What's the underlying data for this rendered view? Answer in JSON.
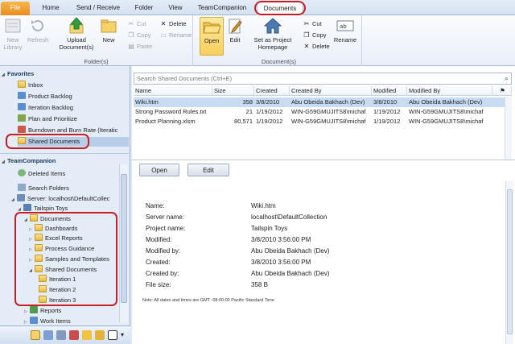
{
  "tabs": [
    {
      "label": "File"
    },
    {
      "label": "Home"
    },
    {
      "label": "Send / Receive"
    },
    {
      "label": "Folder"
    },
    {
      "label": "View"
    },
    {
      "label": "TeamCompanion"
    },
    {
      "label": "Documents"
    }
  ],
  "ribbon": {
    "folder_group": {
      "label": "Folder(s)",
      "new_library": "New Library",
      "refresh": "Refresh",
      "upload": "Upload Document(s)",
      "new": "New",
      "cut": "Cut",
      "copy": "Copy",
      "paste": "Paste",
      "delete": "Delete",
      "rename": "Rename"
    },
    "document_group": {
      "label": "Document(s)",
      "open": "Open",
      "edit": "Edit",
      "set_home": "Set as Project Homepage",
      "cut": "Cut",
      "copy": "Copy",
      "delete": "Delete",
      "rename": "Rename"
    }
  },
  "nav": {
    "favorites_header": "Favorites",
    "favorites": [
      {
        "label": "Inbox"
      },
      {
        "label": "Product Backlog"
      },
      {
        "label": "Iteration Backlog"
      },
      {
        "label": "Plan and Prioritize"
      },
      {
        "label": "Burndown and Burn Rate (Iteratic"
      },
      {
        "label": "Shared Documents"
      }
    ],
    "tc_header": "TeamCompanion",
    "deleted_items": "Deleted Items",
    "search_folders": "Search Folders",
    "server": "Server: localhost\\DefaultCollec",
    "project": "Tailspin Toys",
    "documents": "Documents",
    "doc_folders": [
      {
        "label": "Dashboards"
      },
      {
        "label": "Excel Reports"
      },
      {
        "label": "Process Guidance"
      },
      {
        "label": "Samples and Templates"
      },
      {
        "label": "Shared Documents"
      }
    ],
    "iterations": [
      {
        "label": "Iteration 1"
      },
      {
        "label": "Iteration 2"
      },
      {
        "label": "Iteration 3"
      }
    ],
    "reports": "Reports",
    "work_items": "Work Items"
  },
  "search": {
    "placeholder": "Search Shared Documents (Ctrl+E)"
  },
  "grid": {
    "headers": {
      "name": "Name",
      "size": "Size",
      "created": "Created",
      "created_by": "Created By",
      "modified": "Modified",
      "modified_by": "Modified By"
    },
    "rows": [
      {
        "name": "Wiki.htm",
        "size": "358",
        "created": "3/8/2010",
        "created_by": "Abu Obeida Bakhach (Dev)",
        "modified": "3/8/2010",
        "modified_by": "Abu Obeida Bakhach (Dev)"
      },
      {
        "name": "Strong Password Rules.txt",
        "size": "21",
        "created": "1/19/2012",
        "created_by": "WIN-G59GMUJITS8\\michaf",
        "modified": "1/19/2012",
        "modified_by": "WIN-G59GMUJITS8\\michaf"
      },
      {
        "name": "Product Planning.xlsm",
        "size": "80,571",
        "created": "1/19/2012",
        "created_by": "WIN-G59GMUJITS8\\michaf",
        "modified": "1/19/2012",
        "modified_by": "WIN-G59GMUJITS8\\michaf"
      }
    ]
  },
  "preview": {
    "open": "Open",
    "edit": "Edit",
    "fields": [
      {
        "label": "Name:",
        "value": "Wiki.htm"
      },
      {
        "label": "Server name:",
        "value": "localhost\\DefaultCollection"
      },
      {
        "label": "Project name:",
        "value": "Tailspin Toys"
      },
      {
        "label": "Modified:",
        "value": "3/8/2010 3:56:00 PM"
      },
      {
        "label": "Modified by:",
        "value": "Abu Obeida Bakhach (Dev)"
      },
      {
        "label": "Created:",
        "value": "3/8/2010 3:56:00 PM"
      },
      {
        "label": "Created by:",
        "value": "Abu Obeida Bakhach (Dev)"
      },
      {
        "label": "File size:",
        "value": "358 B"
      }
    ],
    "note": "Note: All dates and times are GMT -08:00:00 Pacific Standard Time"
  },
  "colors": {
    "highlight_ring": "#c81f25",
    "file_tab": "#e88d1f",
    "selection": "#c7dcf3"
  }
}
